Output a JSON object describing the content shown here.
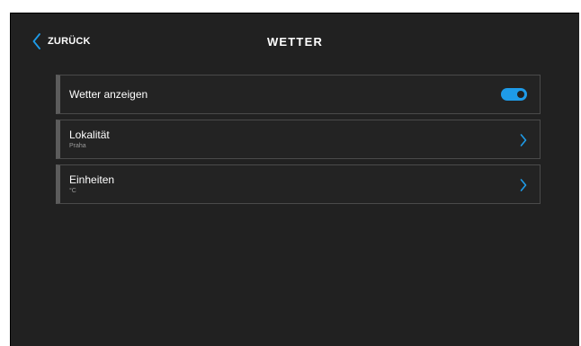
{
  "header": {
    "back_label": "ZURÜCK",
    "title": "WETTER"
  },
  "settings": {
    "items": [
      {
        "label": "Wetter anzeigen",
        "control": "toggle",
        "toggle_on": true
      },
      {
        "label": "Lokalität",
        "value": "Praha",
        "control": "chevron-right-icon"
      },
      {
        "label": "Einheiten",
        "value": "°C",
        "control": "chevron-right-icon"
      }
    ]
  },
  "colors": {
    "background": "#212121",
    "accent": "#1e9be8",
    "text": "#ffffff",
    "subtext": "#9a9a9a",
    "row_border": "#4a4a4a"
  },
  "icons": {
    "back": "chevron-left-icon",
    "item_nav": "chevron-right-icon"
  }
}
